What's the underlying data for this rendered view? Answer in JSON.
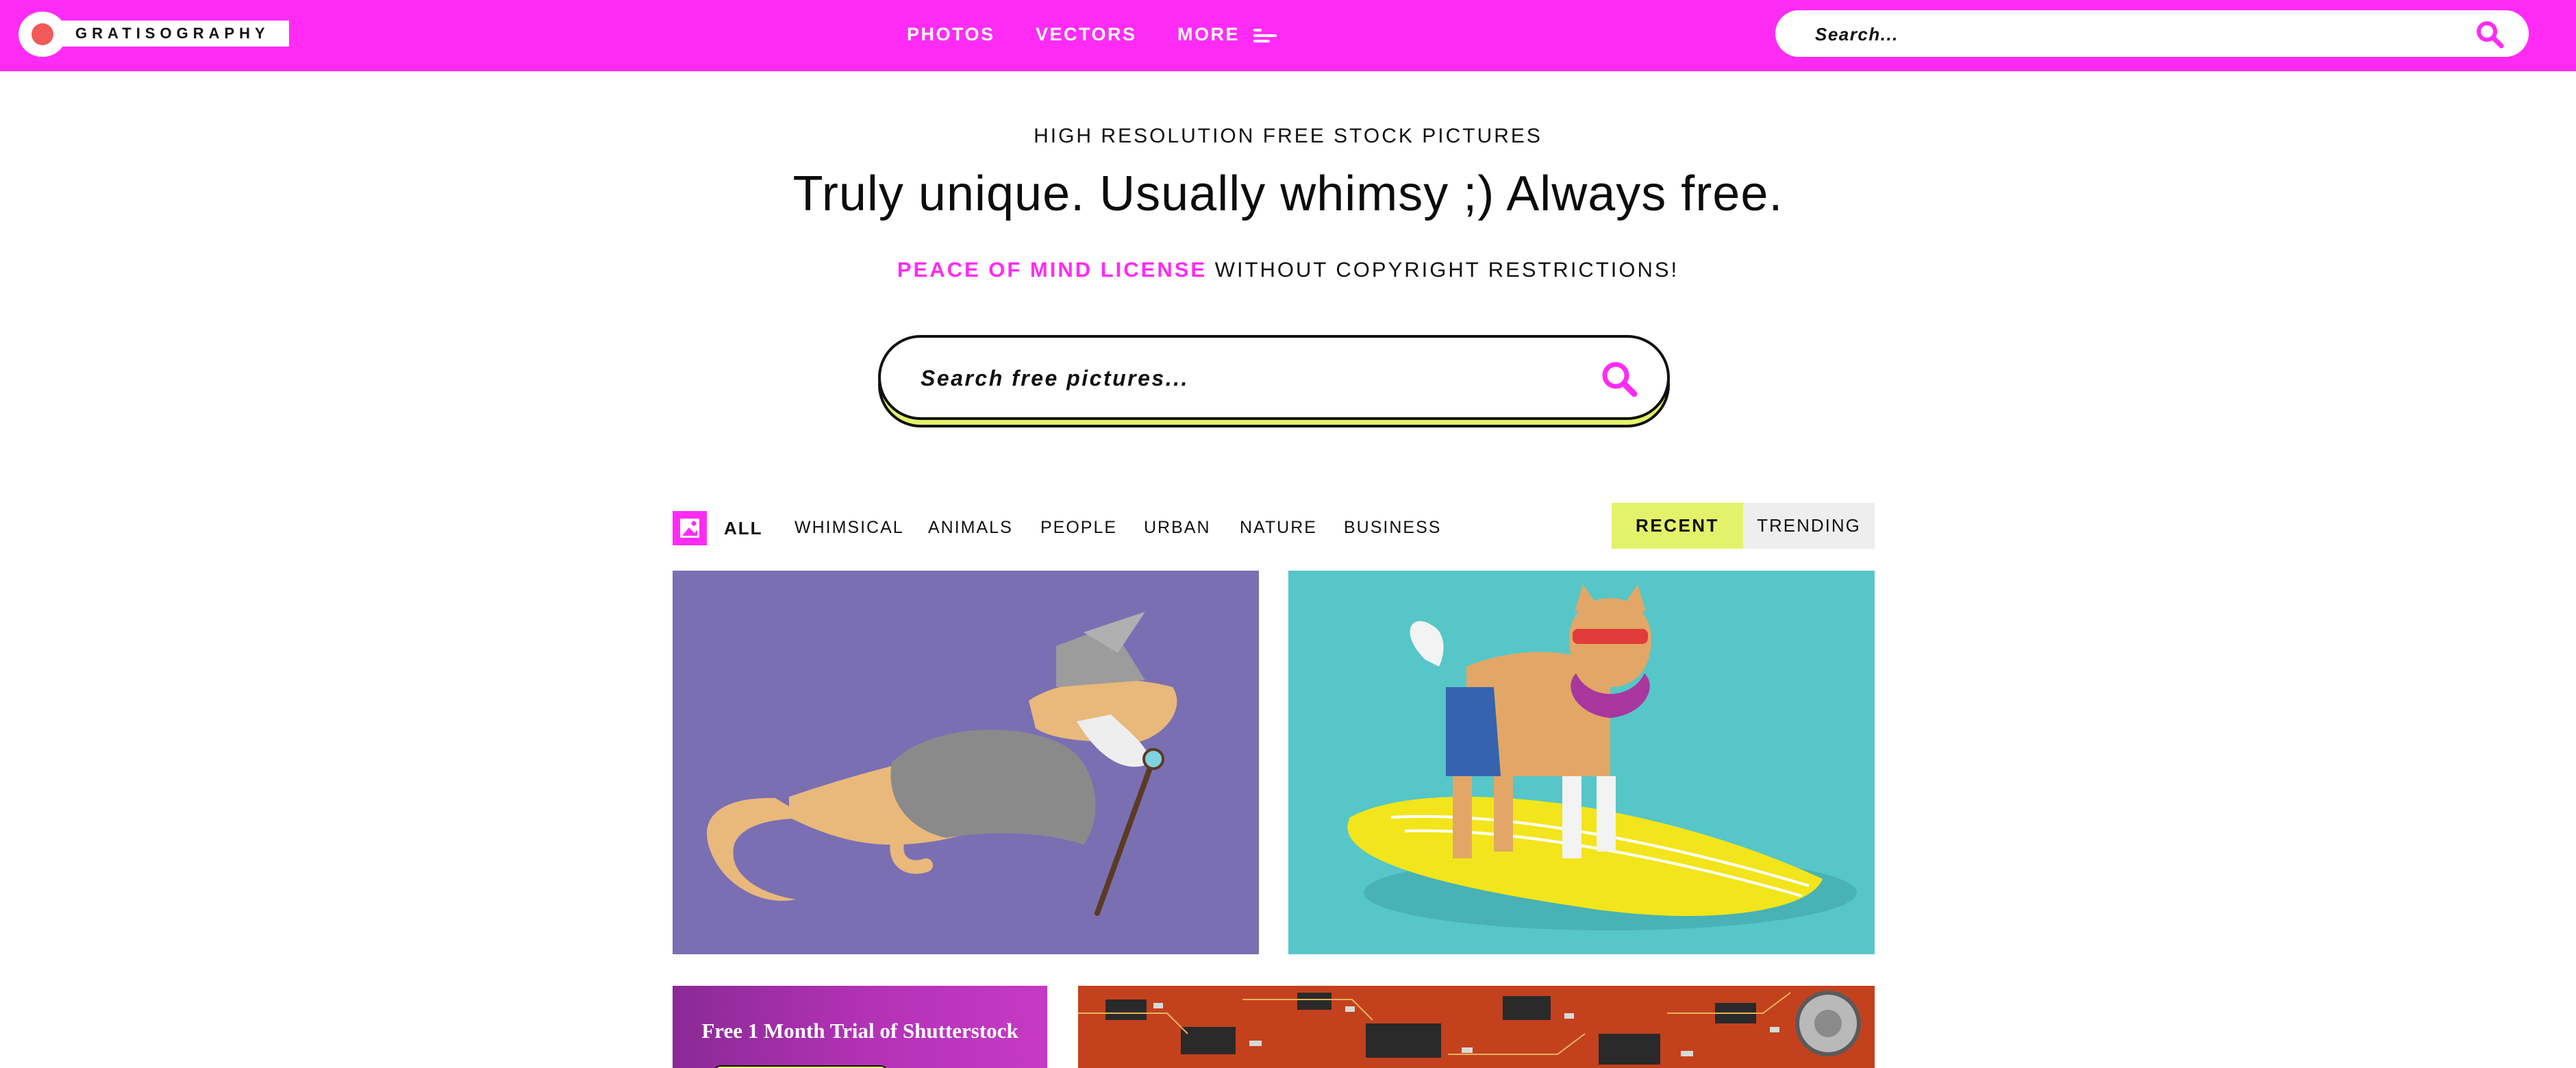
{
  "brand": {
    "name": "GRATISOGRAPHY",
    "colors": {
      "accent": "#ff2bf5",
      "lime": "#e4f26b",
      "logo_dot": "#f25a5a"
    }
  },
  "nav": {
    "links": [
      "PHOTOS",
      "VECTORS",
      "MORE"
    ],
    "more_icon": "menu-lines-icon",
    "search": {
      "placeholder": "Search...",
      "icon": "search-icon"
    }
  },
  "hero": {
    "subheading": "HIGH RESOLUTION FREE STOCK PICTURES",
    "headline": "Truly unique. Usually whimsy ;) Always free.",
    "license_link": "PEACE OF MIND LICENSE",
    "license_text": " WITHOUT COPYRIGHT RESTRICTIONS!",
    "search": {
      "placeholder": "Search free pictures...",
      "icon": "search-icon"
    }
  },
  "filters": {
    "category_icon": "image-icon",
    "categories": [
      {
        "label": "ALL",
        "active": true
      },
      {
        "label": "WHIMSICAL",
        "active": false
      },
      {
        "label": "ANIMALS",
        "active": false
      },
      {
        "label": "PEOPLE",
        "active": false
      },
      {
        "label": "URBAN",
        "active": false
      },
      {
        "label": "NATURE",
        "active": false
      },
      {
        "label": "BUSINESS",
        "active": false
      }
    ],
    "sort": [
      {
        "label": "RECENT",
        "active": true
      },
      {
        "label": "TRENDING",
        "active": false
      }
    ]
  },
  "gallery": {
    "tiles": [
      {
        "subject": "lizard wizard illustration",
        "background": "#7a6fb3"
      },
      {
        "subject": "surfing shiba dog illustration",
        "background": "#56c6c8"
      },
      {
        "subject": "circuit board photo",
        "background": "#c4411d"
      }
    ],
    "ad": {
      "text": "Free 1 Month Trial of Shutterstock"
    }
  }
}
